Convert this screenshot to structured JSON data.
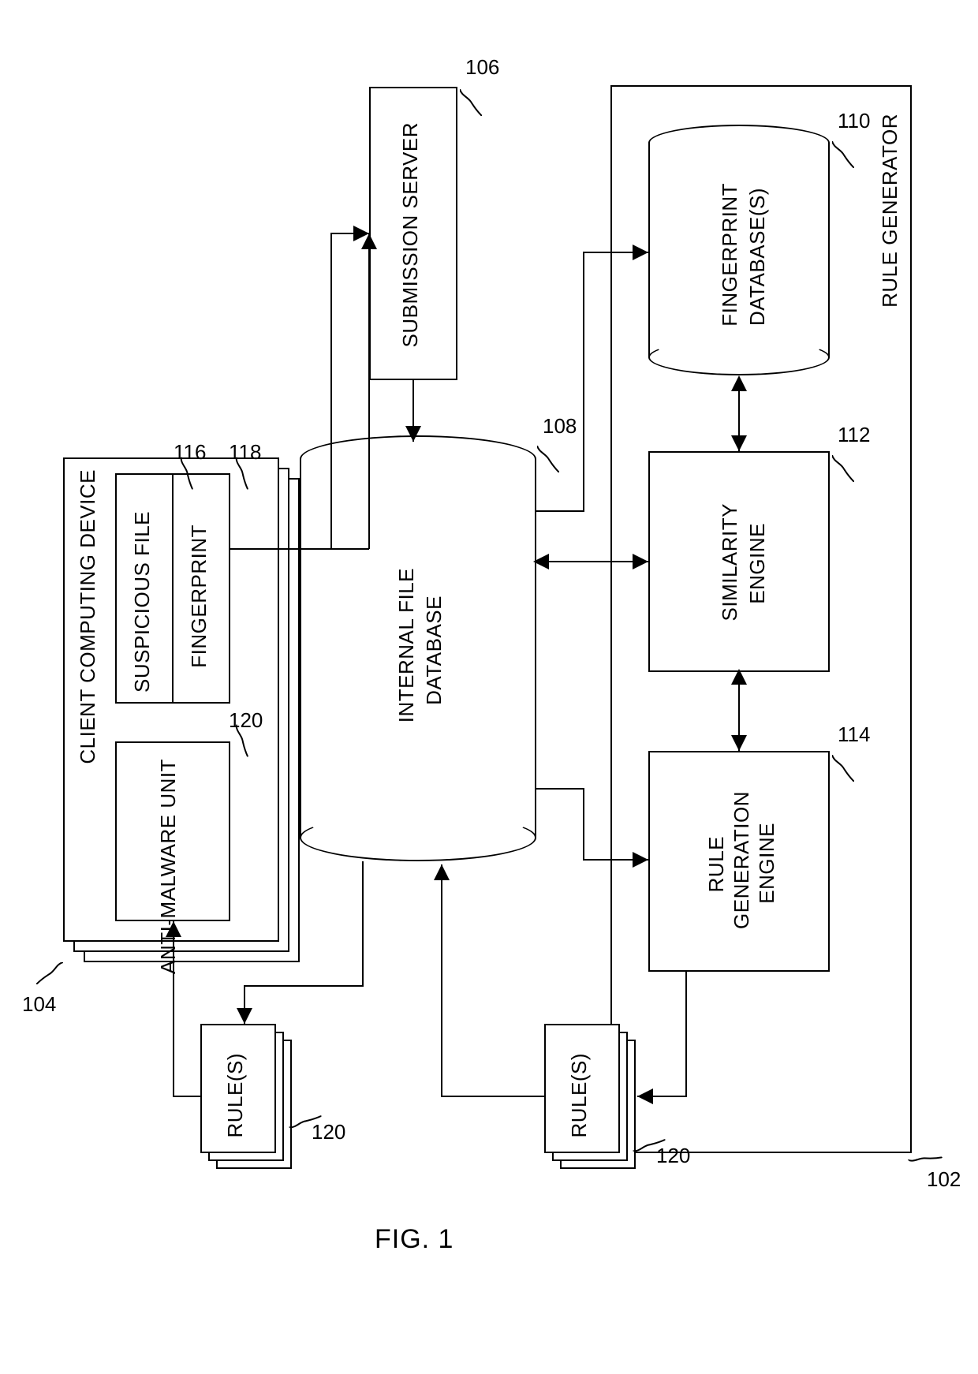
{
  "figure_label": "FIG. 1",
  "refs": {
    "system": "102",
    "client": "104",
    "submission_server": "106",
    "internal_db": "108",
    "fingerprint_db": "110",
    "similarity_engine": "112",
    "rule_gen_engine": "114",
    "suspicious_file": "116",
    "fingerprint": "118",
    "anti_malware": "120",
    "rules_left": "120",
    "rules_right": "120"
  },
  "labels": {
    "client_device": "CLIENT COMPUTING DEVICE",
    "suspicious_file": "SUSPICIOUS FILE",
    "fingerprint": "FINGERPRINT",
    "anti_malware": "ANTI-MALWARE UNIT",
    "submission_server": "SUBMISSION SERVER",
    "internal_db": "INTERNAL FILE\nDATABASE",
    "rule_generator": "RULE GENERATOR",
    "fingerprint_db": "FINGERPRINT\nDATABASE(S)",
    "similarity_engine": "SIMILARITY\nENGINE",
    "rule_gen_engine": "RULE\nGENERATION\nENGINE",
    "rules": "RULE(S)"
  }
}
